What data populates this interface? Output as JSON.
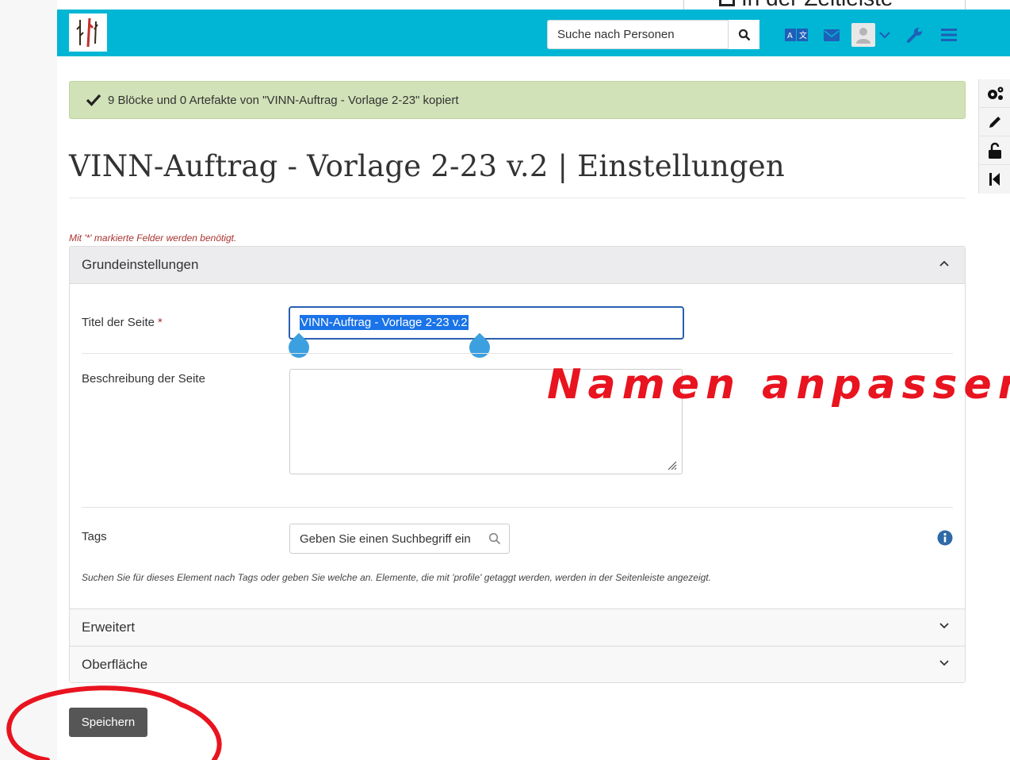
{
  "background_window": {
    "text": "In der Zeitleiste"
  },
  "header": {
    "search": {
      "placeholder": "Suche nach Personen"
    }
  },
  "alert": {
    "text": "9 Blöcke und 0 Artefakte von \"VINN-Auftrag - Vorlage 2-23\" kopiert"
  },
  "page": {
    "title": "VINN-Auftrag - Vorlage 2-23 v.2 | Einstellungen",
    "required_note": "Mit '*' markierte Felder werden benötigt."
  },
  "panel": {
    "basic_title": "Grundeinstellungen",
    "title_label": "Titel der Seite",
    "required_mark": "*",
    "title_value": "VINN-Auftrag - Vorlage 2-23 v.2",
    "description_label": "Beschreibung der Seite",
    "description_value": "",
    "tags_label": "Tags",
    "tags_placeholder": "Geben Sie einen Suchbegriff ein",
    "tags_help": "Suchen Sie für dieses Element nach Tags oder geben Sie welche an. Elemente, die mit 'profile' getaggt werden, werden in der Seitenleiste angezeigt.",
    "advanced_title": "Erweitert",
    "surface_title": "Oberfläche"
  },
  "save_label": "Speichern",
  "annotation": {
    "text": "Namen anpassen"
  },
  "colors": {
    "header": "#00b6d4",
    "alert_bg": "#d1e2b8",
    "annotation": "#e8141f",
    "save_button": "#565656"
  },
  "icons": {
    "header": [
      "search-icon",
      "language-icon",
      "mail-icon",
      "user-avatar-icon",
      "chevron-down-icon",
      "wrench-icon",
      "menu-icon"
    ],
    "tools": [
      "gears-icon",
      "pencil-icon",
      "unlock-icon",
      "back-to-start-icon"
    ]
  }
}
